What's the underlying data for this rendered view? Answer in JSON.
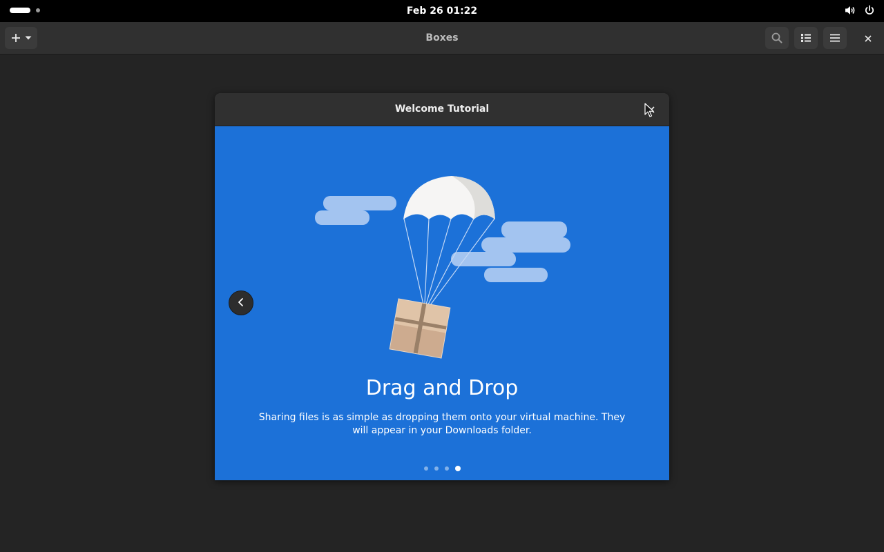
{
  "topbar": {
    "clock": "Feb 26  01:22",
    "icons": [
      "activities-indicator",
      "volume-icon",
      "power-icon"
    ]
  },
  "app": {
    "title": "Boxes",
    "header_icons": [
      "add-icon",
      "chevron-down-icon",
      "search-icon",
      "list-view-icon",
      "hamburger-menu-icon",
      "close-icon"
    ]
  },
  "dialog": {
    "title": "Welcome Tutorial",
    "page": {
      "title": "Drag and Drop",
      "description": "Sharing files is as simple as dropping them onto your virtual machine. They will appear in your Downloads folder.",
      "page_count": 4,
      "current_page": 4
    },
    "colors": {
      "page_background": "#1c71d8",
      "window_background": "#242424",
      "header_background": "#303030"
    }
  }
}
